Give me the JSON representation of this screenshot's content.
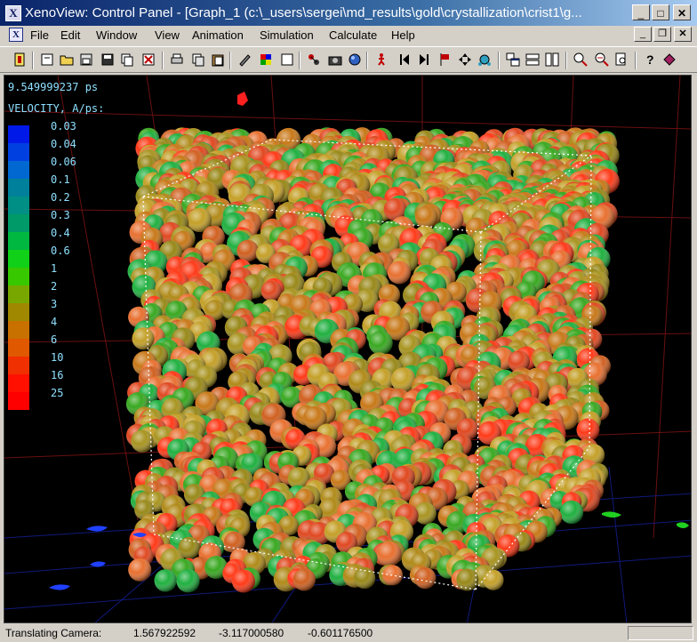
{
  "window": {
    "title": "XenoView: Control Panel - [Graph_1  (c:\\_users\\sergei\\md_results\\gold\\crystallization\\crist1\\g...",
    "icon": "X"
  },
  "menu": {
    "items": [
      "File",
      "Edit",
      "Window",
      "View",
      "Animation",
      "Simulation",
      "Calculate",
      "Help"
    ]
  },
  "toolbar": {
    "icons": [
      "exit-icon",
      "new-icon",
      "open-icon",
      "save-as-icon",
      "save-icon",
      "copy-icon",
      "close-doc-icon",
      "print-icon",
      "copy-clip-icon",
      "paste-icon",
      "pen-icon",
      "color-palette-icon",
      "frame-icon",
      "atoms-icon",
      "camera-icon",
      "sphere-icon",
      "walk-icon",
      "step-back-icon",
      "step-forward-icon",
      "flag-icon",
      "arrows-icon",
      "molecule-icon",
      "tile-icon",
      "horizontal-icon",
      "vertical-icon",
      "zoom-in-icon",
      "zoom-out-icon",
      "zoom-page-icon",
      "help-icon",
      "pointer-icon"
    ]
  },
  "viewport": {
    "time": "9.549999237 ps",
    "legend_title": "VELOCITY, A/ps:",
    "legend": [
      {
        "label": "0.03",
        "color": "#0018e8"
      },
      {
        "label": "0.04",
        "color": "#0040e0"
      },
      {
        "label": "0.06",
        "color": "#0068d0"
      },
      {
        "label": "0.1",
        "color": "#00809a"
      },
      {
        "label": "0.2",
        "color": "#008f84"
      },
      {
        "label": "0.3",
        "color": "#009a68"
      },
      {
        "label": "0.4",
        "color": "#00b840"
      },
      {
        "label": "0.6",
        "color": "#10d018"
      },
      {
        "label": "1",
        "color": "#38c800"
      },
      {
        "label": "2",
        "color": "#78a800"
      },
      {
        "label": "3",
        "color": "#a08800"
      },
      {
        "label": "4",
        "color": "#c87000"
      },
      {
        "label": "6",
        "color": "#e05800"
      },
      {
        "label": "10",
        "color": "#f03000"
      },
      {
        "label": "16",
        "color": "#ff1000"
      },
      {
        "label": "25",
        "color": "#ff0000"
      }
    ]
  },
  "status": {
    "label": "Translating Camera:",
    "x": "1.567922592",
    "y": "-3.117000580",
    "z": "-0.601176500"
  }
}
